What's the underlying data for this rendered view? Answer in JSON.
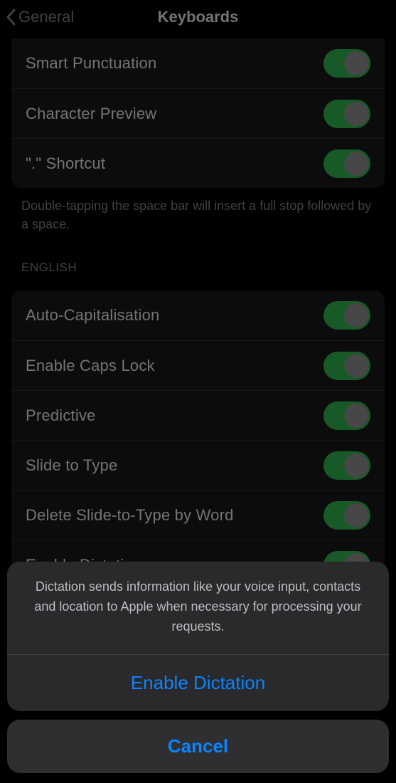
{
  "nav": {
    "back_label": "General",
    "title": "Keyboards"
  },
  "group1": {
    "items": [
      {
        "label": "Smart Punctuation",
        "on": true
      },
      {
        "label": "Character Preview",
        "on": true
      },
      {
        "label": "\".\" Shortcut",
        "on": true
      }
    ],
    "footer": "Double-tapping the space bar will insert a full stop followed by a space."
  },
  "section_english": "ENGLISH",
  "group2": {
    "items": [
      {
        "label": "Auto-Capitalisation",
        "on": true
      },
      {
        "label": "Enable Caps Lock",
        "on": true
      },
      {
        "label": "Predictive",
        "on": true
      },
      {
        "label": "Slide to Type",
        "on": true
      },
      {
        "label": "Delete Slide-to-Type by Word",
        "on": true
      },
      {
        "label": "Enable Dictation",
        "on": true
      }
    ]
  },
  "sheet": {
    "message": "Dictation sends information like your voice input, contacts and location to Apple when necessary for processing your requests.",
    "action": "Enable Dictation",
    "cancel": "Cancel"
  }
}
